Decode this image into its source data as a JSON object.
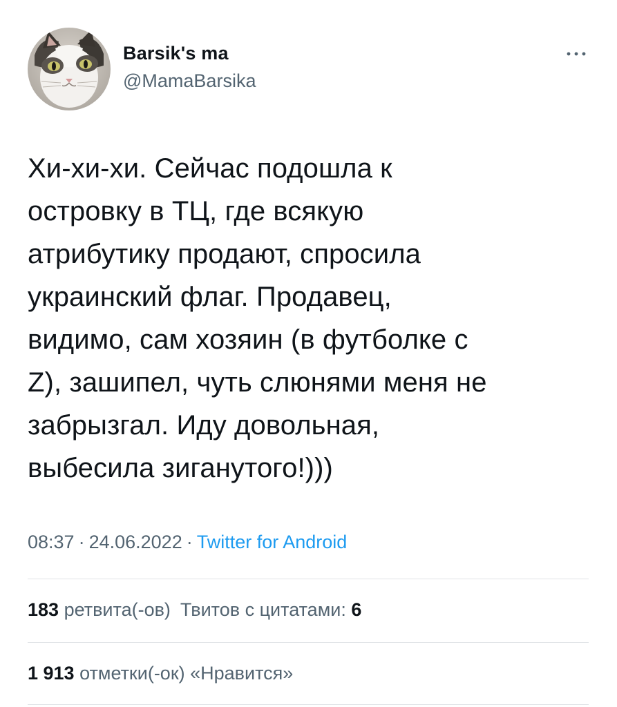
{
  "author": {
    "display_name": "Barsik's ma",
    "handle": "@MamaBarsika",
    "avatar_icon": "cat-photo-avatar"
  },
  "more_icon": "more-horizontal-icon",
  "tweet": {
    "text": "Хи-хи-хи. Сейчас подошла к\nостровку в ТЦ, где всякую\nатрибутику продают, спросила\nукраинский флаг. Продавец,\nвидимо, сам хозяин (в футболке с\nZ), зашипел, чуть слюнями меня не\nзабрызгал. Иду довольная,\nвыбесила зиганутого!)))",
    "time": "08:37",
    "separator": "·",
    "date": "24.06.2022",
    "source": "Twitter for Android"
  },
  "stats": {
    "retweets_count": "183",
    "retweets_label": "ретвита(-ов)",
    "quotes_label": "Твитов с цитатами:",
    "quotes_count": "6",
    "likes_count": "1 913",
    "likes_label": "отметки(-ок) «Нравится»"
  },
  "colors": {
    "text": "#0f1419",
    "secondary": "#536471",
    "link": "#1d9bf0",
    "divider": "#dfe3e6"
  }
}
